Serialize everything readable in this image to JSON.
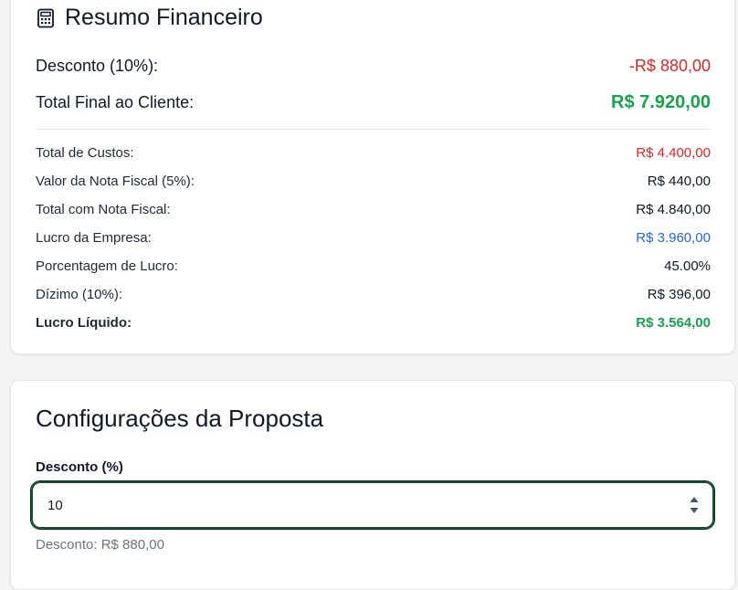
{
  "summary": {
    "title": "Resumo Financeiro",
    "icon": "calculator-icon",
    "discount_label": "Desconto (10%):",
    "discount_value": "-R$ 880,00",
    "total_label": "Total Final ao Cliente:",
    "total_value": "R$ 7.920,00",
    "rows": [
      {
        "label": "Total de Custos:",
        "value": "R$ 4.400,00"
      },
      {
        "label": "Valor da Nota Fiscal (5%):",
        "value": "R$ 440,00"
      },
      {
        "label": "Total com Nota Fiscal:",
        "value": "R$ 4.840,00"
      },
      {
        "label": "Lucro da Empresa:",
        "value": "R$ 3.960,00"
      },
      {
        "label": "Porcentagem de Lucro:",
        "value": "45.00%"
      },
      {
        "label": "Dízimo (10%):",
        "value": "R$ 396,00"
      },
      {
        "label": "Lucro Líquido:",
        "value": "R$ 3.564,00"
      }
    ]
  },
  "config": {
    "title": "Configurações da Proposta",
    "discount_field_label": "Desconto (%)",
    "discount_field_value": "10",
    "discount_hint": "Desconto: R$ 880,00"
  },
  "colors": {
    "negative": "#dc2626",
    "positive": "#16a34a",
    "profit": "#2563eb",
    "input_border": "#14532d"
  }
}
